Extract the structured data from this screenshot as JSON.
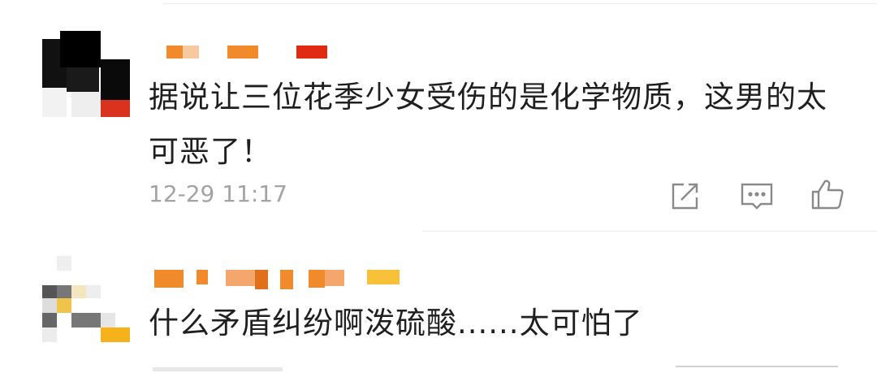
{
  "comments": [
    {
      "text": "据说让三位花季少女受伤的是化学物质，这男的太可恶了！",
      "timestamp": "12-29 11:17"
    },
    {
      "text": "什么矛盾纠纷啊泼硫酸......太可怕了"
    }
  ],
  "colors": {
    "text": "#1f1f1f",
    "meta": "#a3a3a3",
    "icon": "#8a8a8a",
    "username_accent": "#f08a2a",
    "divider": "#ececec"
  },
  "icons": [
    "share-icon",
    "comment-icon",
    "like-icon"
  ]
}
